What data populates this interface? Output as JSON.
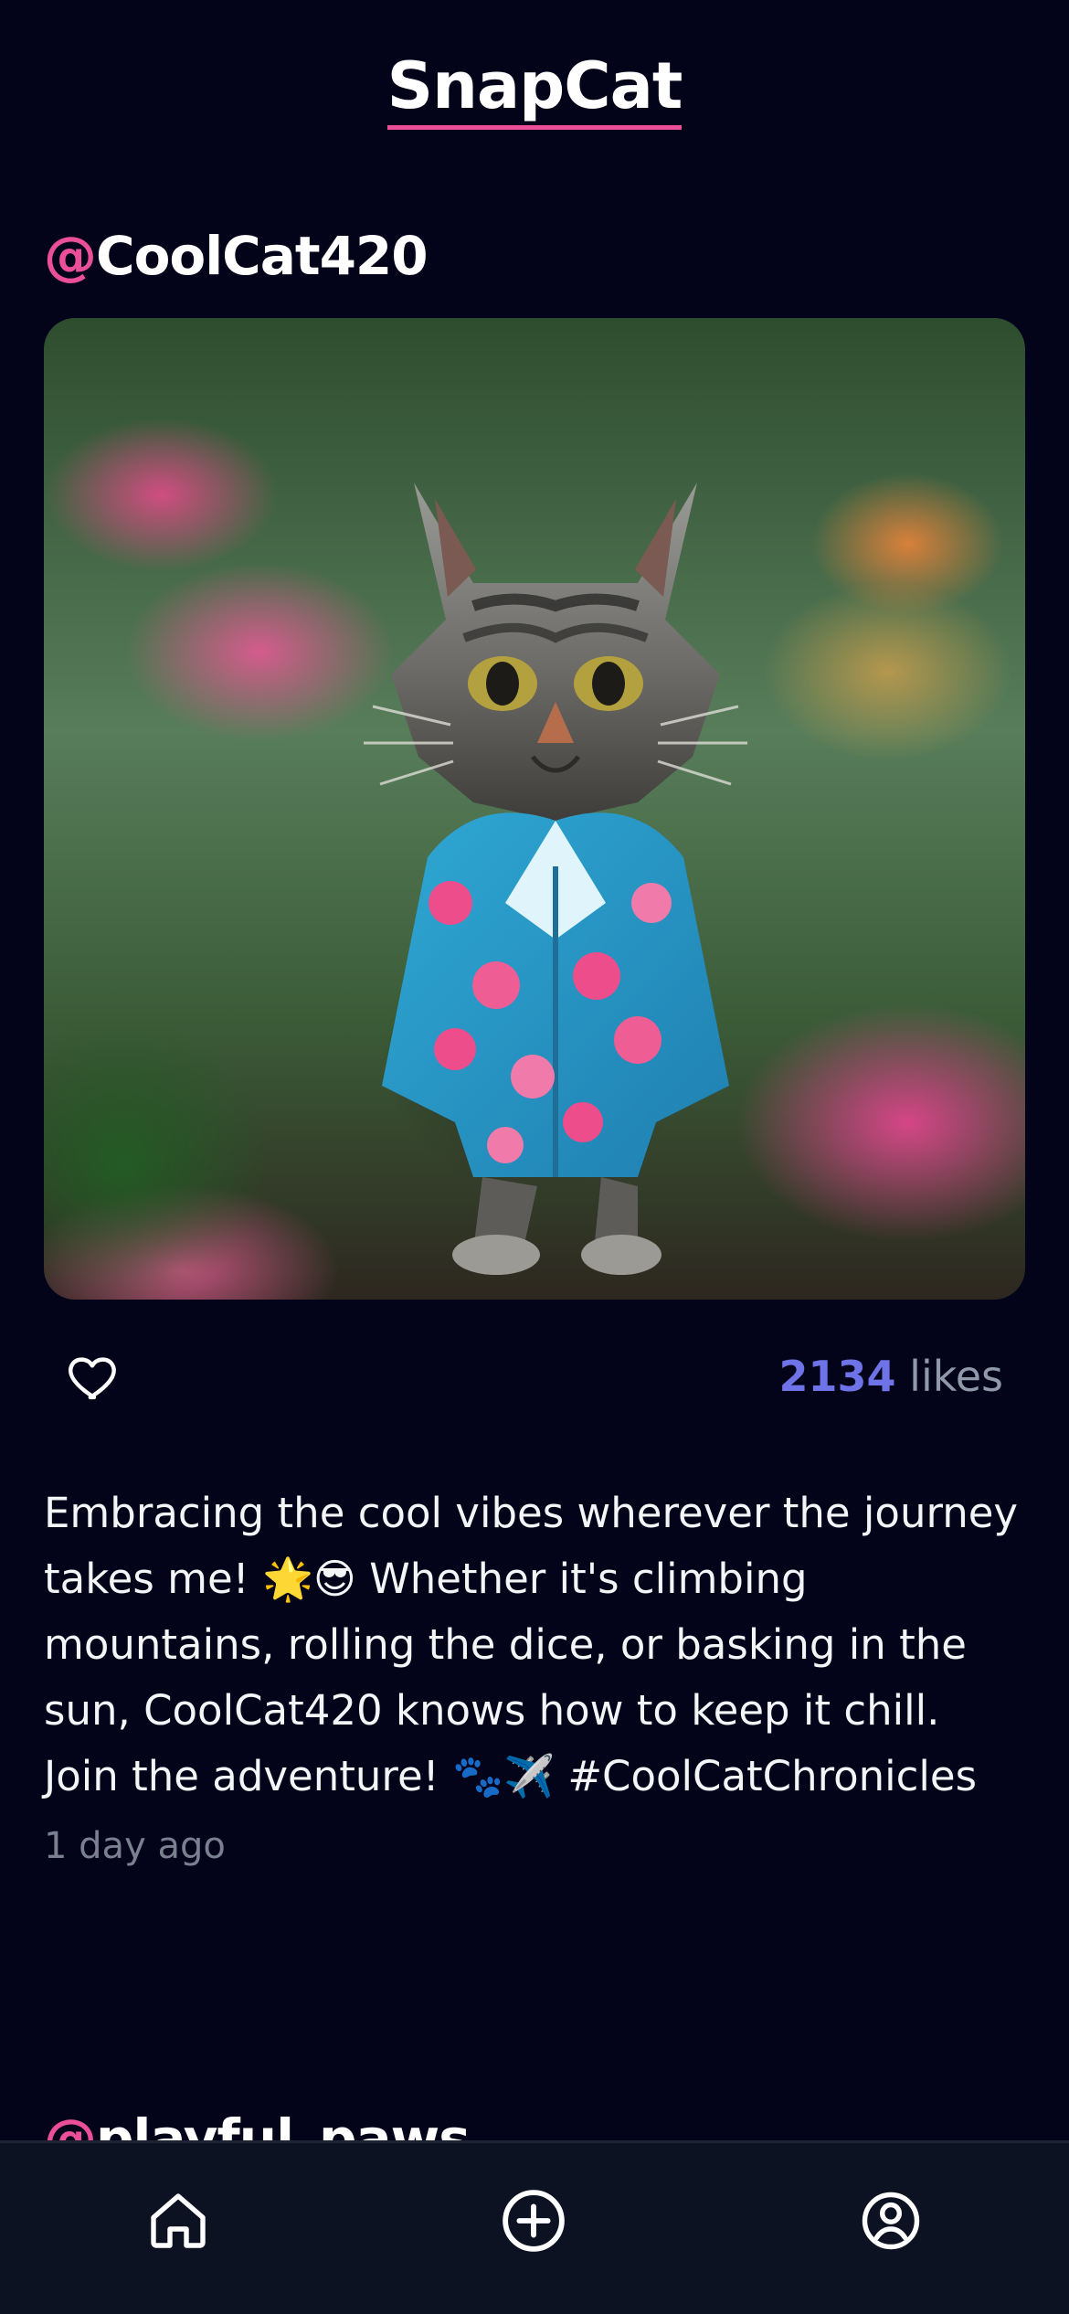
{
  "app": {
    "brand": "SnapCat"
  },
  "posts": [
    {
      "at_symbol": "@",
      "username": "CoolCat420",
      "likes_count": "2134",
      "likes_label": "likes",
      "caption": "Embracing the cool vibes wherever the journey takes me! 🌟😎 Whether it's climbing mountains, rolling the dice, or basking in the sun, CoolCat420 knows how to keep it chill. Join the adventure! 🐾✈️ #CoolCatChronicles",
      "timestamp": "1 day ago",
      "image_subject": "cat-in-hawaiian-shirt-among-flowers"
    },
    {
      "at_symbol": "@",
      "username": "playful_paws"
    }
  ],
  "bottom_nav": {
    "items": [
      {
        "icon": "home-icon"
      },
      {
        "icon": "plus-circle-icon"
      },
      {
        "icon": "user-circle-icon"
      }
    ]
  },
  "colors": {
    "background": "#03031a",
    "accent": "#ec4f9a",
    "likes_accent": "#6f73e8",
    "secondary_text": "#8f99a8",
    "nav_background": "#0d1223"
  }
}
